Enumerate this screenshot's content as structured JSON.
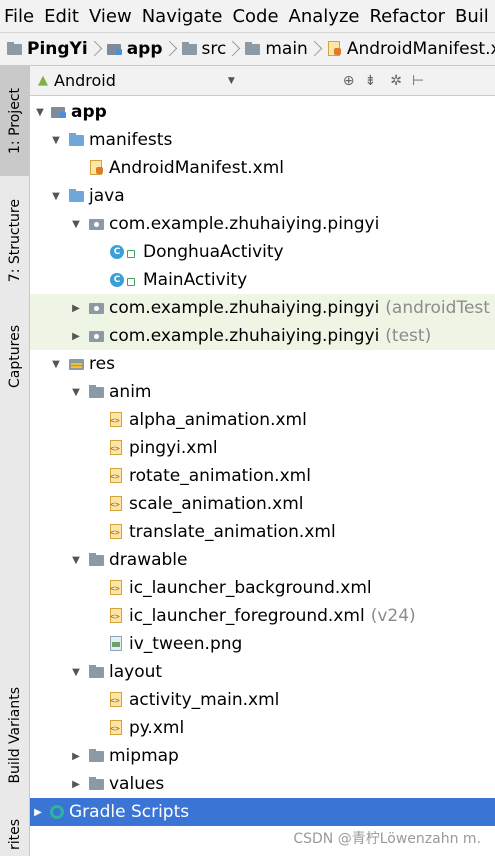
{
  "menubar": {
    "items": [
      "File",
      "Edit",
      "View",
      "Navigate",
      "Code",
      "Analyze",
      "Refactor",
      "Buil"
    ]
  },
  "breadcrumb": {
    "items": [
      "PingYi",
      "app",
      "src",
      "main",
      "AndroidManifest.xml"
    ]
  },
  "sidebar": {
    "tabs": [
      "1: Project",
      "7: Structure",
      "Captures",
      "Build Variants",
      "rites"
    ]
  },
  "panel": {
    "view_label": "Android"
  },
  "tree": {
    "app": "app",
    "manifests": "manifests",
    "manifest_file": "AndroidManifest.xml",
    "java": "java",
    "pkg_main": "com.example.zhuhaiying.pingyi",
    "class_1": "DonghuaActivity",
    "class_2": "MainActivity",
    "pkg_android_test": "com.example.zhuhaiying.pingyi",
    "pkg_android_test_suffix": "(androidTest",
    "pkg_test": "com.example.zhuhaiying.pingyi",
    "pkg_test_suffix": "(test)",
    "res": "res",
    "anim": "anim",
    "anim_files": [
      "alpha_animation.xml",
      "pingyi.xml",
      "rotate_animation.xml",
      "scale_animation.xml",
      "translate_animation.xml"
    ],
    "drawable": "drawable",
    "drawable_1": "ic_launcher_background.xml",
    "drawable_2": "ic_launcher_foreground.xml",
    "drawable_2_suffix": "(v24)",
    "drawable_3": "iv_tween.png",
    "layout": "layout",
    "layout_files": [
      "activity_main.xml",
      "py.xml"
    ],
    "mipmap": "mipmap",
    "values": "values",
    "gradle": "Gradle Scripts"
  },
  "watermark": "CSDN @青柠Löwenzahn m.",
  "colors": {
    "selection": "#3a75d6",
    "test_highlight": "#eef5e5",
    "folder_blue": "#6fa8d8"
  }
}
